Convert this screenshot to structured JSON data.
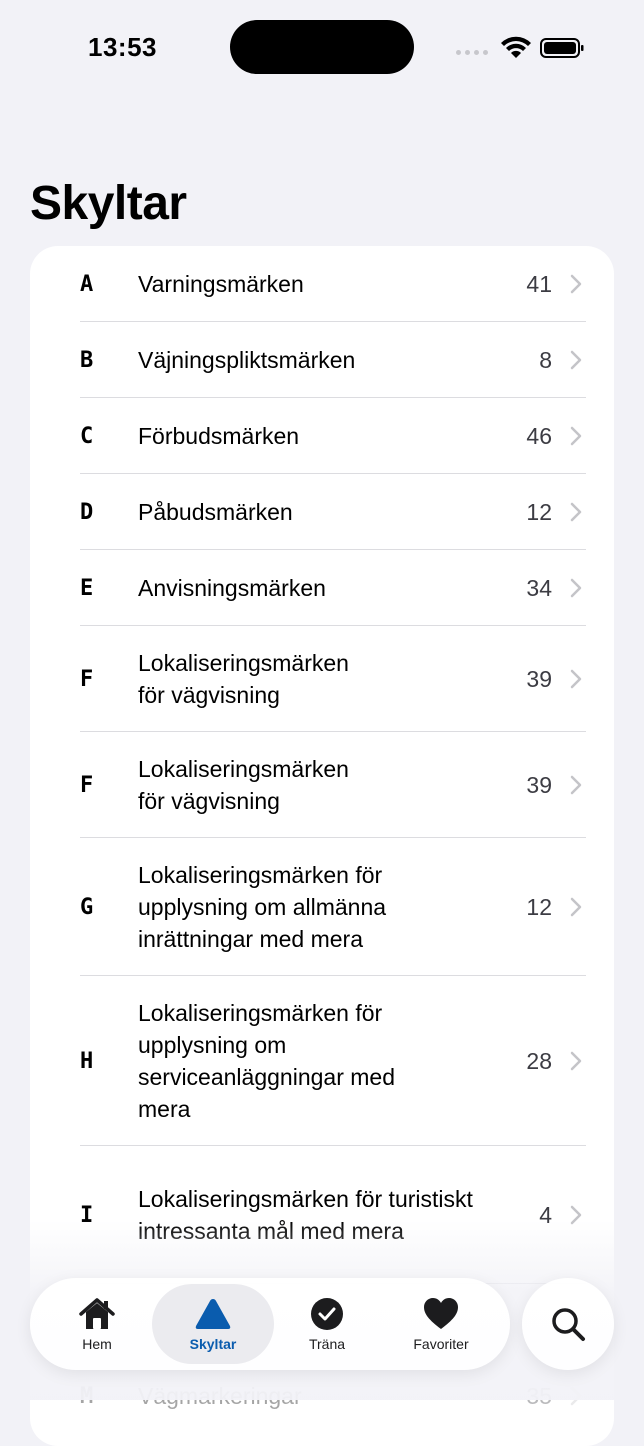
{
  "status": {
    "time": "13:53"
  },
  "page": {
    "title": "Skyltar"
  },
  "categories": [
    {
      "letter": "A",
      "name": "Varningsmärken",
      "count": "41"
    },
    {
      "letter": "B",
      "name": "Väjningspliktsmärken",
      "count": "8"
    },
    {
      "letter": "C",
      "name": "Förbudsmärken",
      "count": "46"
    },
    {
      "letter": "D",
      "name": "Påbudsmärken",
      "count": "12"
    },
    {
      "letter": "E",
      "name": "Anvisningsmärken",
      "count": "34"
    },
    {
      "letter": "F",
      "name": "Lokaliseringsmärken\nför vägvisning",
      "count": "39"
    },
    {
      "letter": "F",
      "name": "Lokaliseringsmärken\nför vägvisning",
      "count": "39"
    },
    {
      "letter": "G",
      "name": "Lokaliseringsmärken för upplysning om allmänna inrättningar med mera",
      "count": "12"
    },
    {
      "letter": "H",
      "name": "Lokaliseringsmärken för upplysning om serviceanläggningar med mera",
      "count": "28"
    },
    {
      "letter": "I",
      "name": "Lokaliseringsmärken för turistiskt intressanta mål med mera",
      "count": "4"
    },
    {
      "letter": "M",
      "name": "Vägmarkeringar",
      "count": "35"
    }
  ],
  "tabs": [
    {
      "label": "Hem",
      "icon": "house-icon"
    },
    {
      "label": "Skyltar",
      "icon": "triangle-sign-icon",
      "active": true
    },
    {
      "label": "Träna",
      "icon": "checkmark-circle-icon"
    },
    {
      "label": "Favoriter",
      "icon": "heart-icon"
    }
  ],
  "search": {
    "icon": "search-icon"
  },
  "colors": {
    "accent": "#0a5cae",
    "background": "#f2f2f7"
  }
}
